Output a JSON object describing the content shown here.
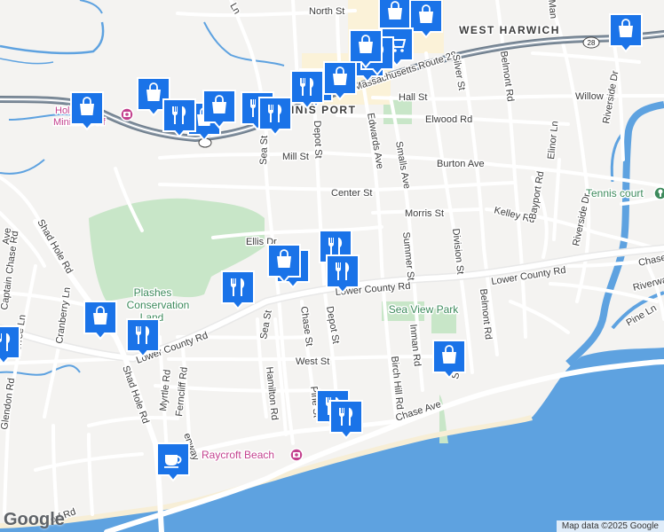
{
  "map": {
    "area": "West Harwich / Harwich Port, MA",
    "attribution": "Map data ©2025 Google",
    "logo": "Google",
    "colors": {
      "land": "#f4f3f1",
      "water": "#5ea2e0",
      "park": "#c8e6c8",
      "road": "#ffffff",
      "route": "#7b8a99",
      "marker": "#1a73e8",
      "label": "#3c3c3c"
    },
    "places": {
      "west_harwich": "WEST HARWICH",
      "harwich_port": "NNIS PORT",
      "sea_view_park": "Sea View Park",
      "plashes_1": "Plashes",
      "plashes_2": "Conservation",
      "plashes_3": "Land",
      "holiday_hill_1": "Hol         ill",
      "holiday_hill_2": "Miniatu    Golf",
      "raycroft_beach": "Raycroft Beach",
      "tennis_court": "Tennis court"
    },
    "roads": {
      "north_st": "North St",
      "ln": "Ln",
      "route_28": "Massachusetts Route 28",
      "route_28_short": "28",
      "hall_st": "Hall St",
      "willow_st": "Willow St",
      "elwood_rd": "Elwood Rd",
      "mill_st": "Mill St",
      "burton_ave": "Burton Ave",
      "center_st": "Center St",
      "morris_st": "Morris St",
      "kelley_rd": "Kelley Rd",
      "ellis_dr": "Ellis Dr",
      "lower_county_rd_1": "Lower County Rd",
      "lower_county_rd_2": "Lower County Rd",
      "lower_county_rd_3": "Lower County Rd",
      "west_st": "West St",
      "chase_ave": "Chase Ave",
      "chase_ave_right": "Chase",
      "sea_st": "Sea St",
      "sea_st_2": "Sea St",
      "depot_st": "Depot St",
      "depot_st_2": "Depot St",
      "edwards_ave": "Edwards Ave",
      "smalls_ave": "Smalls Ave",
      "silver_st": "Silver St",
      "belmont_rd": "Belmont Rd",
      "belmont_rd_2": "Belmont Rd",
      "division_st": "Division St",
      "summer_st": "Summer St",
      "inman_rd": "Inman Rd",
      "birch_hill_rd": "Birch Hill Rd",
      "pine_st": "Pine St",
      "chase_st": "Chase St",
      "hamilton_rd": "Hamilton Rd",
      "riverside_dr": "Riverside Dr",
      "riverside_dr_2": "Riverside Dr",
      "riverway": "Riverwa",
      "pine_ln": "Pine Ln",
      "bayport_rd": "Bayport Rd",
      "elinor_ln": "Elinor Ln",
      "shad_hole_rd": "Shad Hole Rd",
      "shad_hole_rd_2": "Shad Hole Rd",
      "captain_chase_rd": "Captain Chase Rd",
      "cranberry_ln": "Cranberry Ln",
      "lorree_ln": "Lorree Ln",
      "glendon_rd": "Glendon Rd",
      "myrtle_rd": "Myrtle Rd",
      "ferncliff_rd": "Ferncliff Rd",
      "enway": "enway",
      "ave_left": "Ave",
      "orf_rd": "orf Rd",
      "st_partial": "St",
      "manor": "Man"
    },
    "markers": [
      {
        "type": "shopping",
        "icon": "shopping-bag-icon"
      },
      {
        "type": "shopping",
        "icon": "shopping-bag-icon"
      },
      {
        "type": "shopping",
        "icon": "shopping-bag-icon"
      },
      {
        "type": "shopping",
        "icon": "shopping-cart-icon"
      },
      {
        "type": "restaurant",
        "icon": "fork-knife-icon"
      },
      {
        "type": "restaurant",
        "icon": "fork-knife-icon"
      },
      {
        "type": "shopping",
        "icon": "shopping-bag-icon"
      },
      {
        "type": "restaurant",
        "icon": "fork-knife-icon"
      },
      {
        "type": "shopping",
        "icon": "shopping-bag-icon"
      },
      {
        "type": "restaurant",
        "icon": "fork-knife-icon"
      },
      {
        "type": "shopping",
        "icon": "shopping-bag-icon"
      },
      {
        "type": "shopping",
        "icon": "shopping-bag-icon"
      },
      {
        "type": "shopping",
        "icon": "shopping-bag-icon"
      },
      {
        "type": "restaurant",
        "icon": "fork-knife-icon"
      },
      {
        "type": "shopping",
        "icon": "shopping-bag-icon"
      },
      {
        "type": "restaurant",
        "icon": "fork-knife-icon"
      },
      {
        "type": "restaurant",
        "icon": "fork-knife-icon"
      },
      {
        "type": "restaurant",
        "icon": "fork-knife-icon"
      },
      {
        "type": "restaurant",
        "icon": "fork-knife-icon"
      },
      {
        "type": "shopping",
        "icon": "shopping-bag-icon"
      },
      {
        "type": "restaurant",
        "icon": "fork-knife-icon"
      },
      {
        "type": "restaurant",
        "icon": "fork-knife-icon"
      },
      {
        "type": "shopping",
        "icon": "shopping-bag-icon"
      },
      {
        "type": "restaurant",
        "icon": "fork-knife-icon"
      },
      {
        "type": "shopping",
        "icon": "shopping-bag-icon"
      },
      {
        "type": "restaurant",
        "icon": "fork-knife-icon"
      },
      {
        "type": "restaurant",
        "icon": "fork-knife-icon"
      },
      {
        "type": "restaurant",
        "icon": "fork-knife-icon"
      },
      {
        "type": "cafe",
        "icon": "coffee-cup-icon"
      }
    ]
  }
}
